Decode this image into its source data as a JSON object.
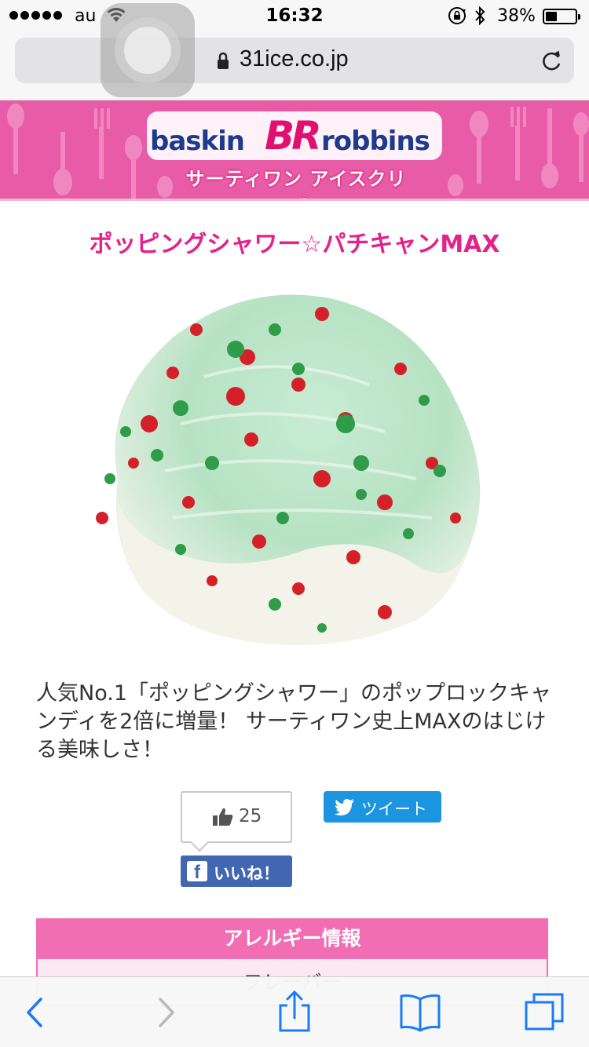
{
  "status_bar": {
    "carrier": "au",
    "time": "16:32",
    "battery_percent": "38%",
    "battery_level": 0.38
  },
  "browser": {
    "url": "31ice.co.jp"
  },
  "site": {
    "logo_left": "baskin",
    "logo_mark": "BR",
    "logo_right": "robbins",
    "logo_subtitle": "サーティワン アイスクリーム"
  },
  "product": {
    "title": "ポッピングシャワー☆パチキャンMAX",
    "description": "人気No.1「ポッピングシャワー」のポップロックキャンディを2倍に増量！ サーティワン史上MAXのはじける美味しさ！"
  },
  "social": {
    "like_count": "25",
    "facebook_like_label": "いいね！",
    "tweet_label": "ツイート"
  },
  "allergy": {
    "header": "アレルギー情報",
    "first_row": "フレーバー"
  },
  "colors": {
    "accent_pink": "#e4228b",
    "banner_pink": "#e85ca7",
    "facebook_blue": "#4267b2",
    "twitter_blue": "#1b95e0",
    "ios_blue": "#1a7cf5"
  },
  "icons": [
    "wifi-icon",
    "rotation-lock-icon",
    "bluetooth-icon",
    "battery-icon",
    "padlock-icon",
    "reload-icon",
    "thumbs-up-icon",
    "facebook-icon",
    "twitter-bird-icon",
    "back-icon",
    "forward-icon",
    "share-icon",
    "bookmarks-icon",
    "tabs-icon"
  ]
}
